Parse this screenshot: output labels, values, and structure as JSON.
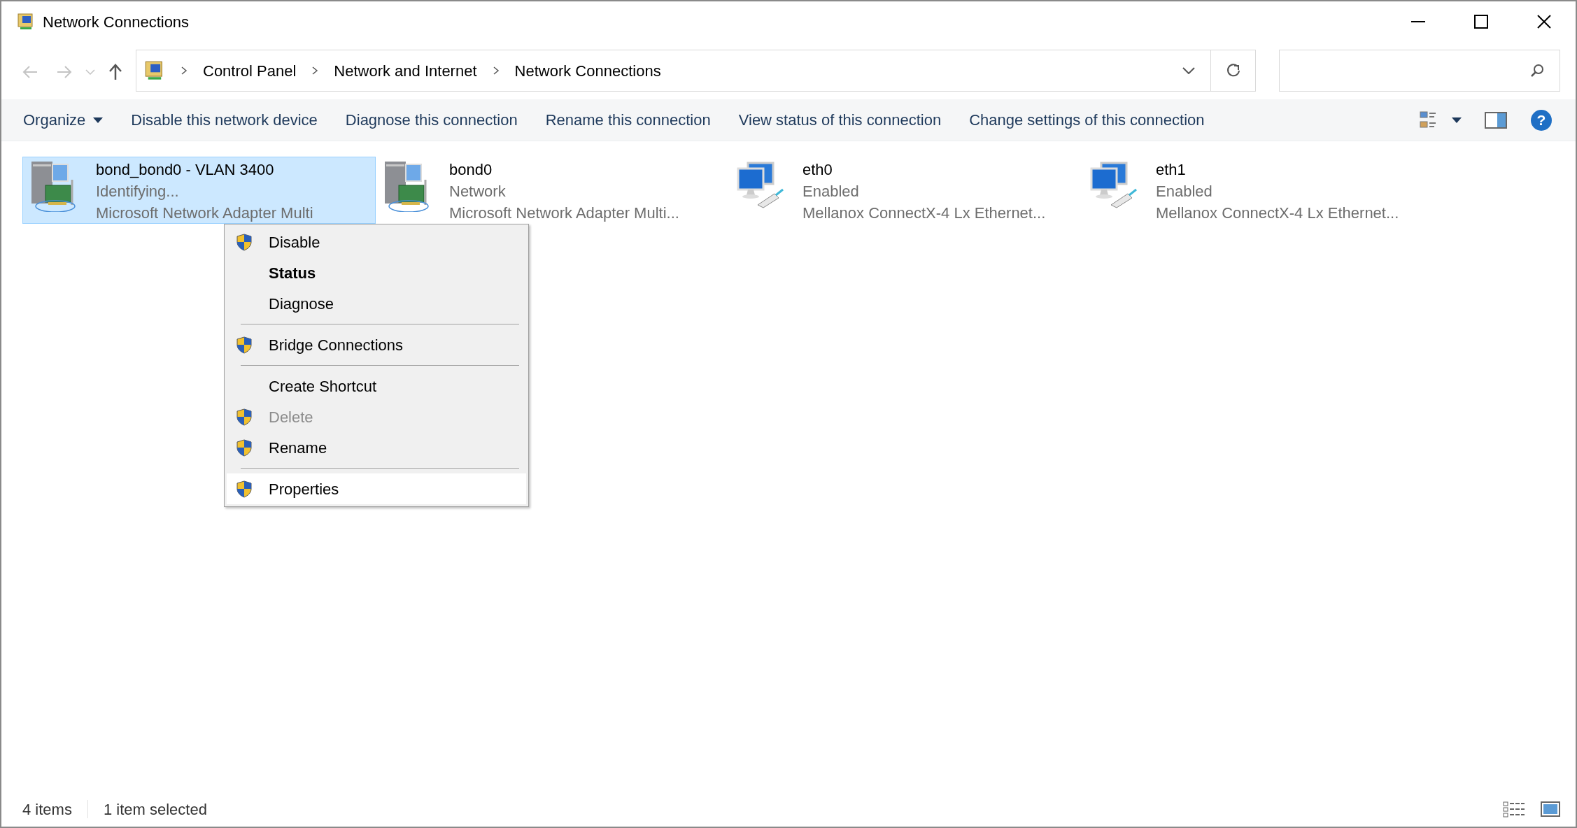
{
  "window": {
    "title": "Network Connections"
  },
  "breadcrumb": [
    "Control Panel",
    "Network and Internet",
    "Network Connections"
  ],
  "commands": [
    {
      "label": "Organize",
      "dropdown": true
    },
    {
      "label": "Disable this network device",
      "dropdown": false
    },
    {
      "label": "Diagnose this connection",
      "dropdown": false
    },
    {
      "label": "Rename this connection",
      "dropdown": false
    },
    {
      "label": "View status of this connection",
      "dropdown": false
    },
    {
      "label": "Change settings of this connection",
      "dropdown": false
    }
  ],
  "help_button": {
    "glyph": "?"
  },
  "connections": [
    {
      "name": "bond_bond0 - VLAN 3400",
      "status": "Identifying...",
      "device": "Microsoft Network Adapter Multi",
      "kind": "adapter",
      "selected": true
    },
    {
      "name": "bond0",
      "status": "Network",
      "device": "Microsoft Network Adapter Multi...",
      "kind": "adapter",
      "selected": false
    },
    {
      "name": "eth0",
      "status": "Enabled",
      "device": "Mellanox ConnectX-4 Lx Ethernet...",
      "kind": "ethernet",
      "selected": false
    },
    {
      "name": "eth1",
      "status": "Enabled",
      "device": "Mellanox ConnectX-4 Lx Ethernet...",
      "kind": "ethernet",
      "selected": false
    }
  ],
  "context_menu": [
    {
      "kind": "item",
      "label": "Disable",
      "shield": true,
      "default": false,
      "disabled": false,
      "selected": false
    },
    {
      "kind": "item",
      "label": "Status",
      "shield": false,
      "default": true,
      "disabled": false,
      "selected": false
    },
    {
      "kind": "item",
      "label": "Diagnose",
      "shield": false,
      "default": false,
      "disabled": false,
      "selected": false
    },
    {
      "kind": "separator"
    },
    {
      "kind": "item",
      "label": "Bridge Connections",
      "shield": true,
      "default": false,
      "disabled": false,
      "selected": false
    },
    {
      "kind": "separator"
    },
    {
      "kind": "item",
      "label": "Create Shortcut",
      "shield": false,
      "default": false,
      "disabled": false,
      "selected": false
    },
    {
      "kind": "item",
      "label": "Delete",
      "shield": true,
      "default": false,
      "disabled": true,
      "selected": false
    },
    {
      "kind": "item",
      "label": "Rename",
      "shield": true,
      "default": false,
      "disabled": false,
      "selected": false
    },
    {
      "kind": "separator"
    },
    {
      "kind": "item",
      "label": "Properties",
      "shield": true,
      "default": false,
      "disabled": false,
      "selected": true
    }
  ],
  "status_bar": {
    "count": "4 items",
    "selection": "1 item selected"
  }
}
